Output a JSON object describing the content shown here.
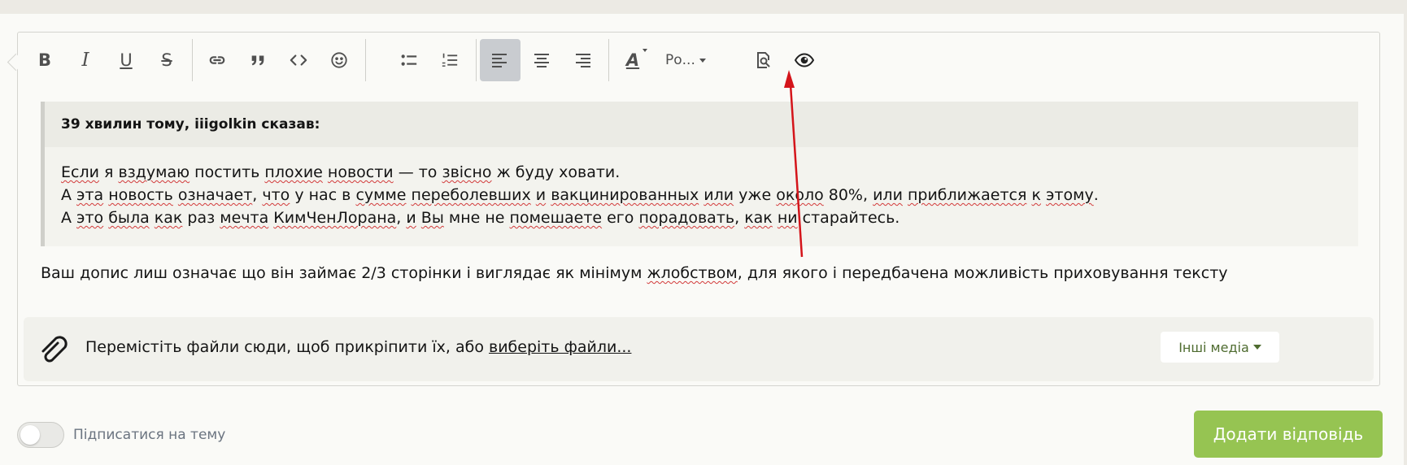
{
  "toolbar": {
    "buttons": [
      {
        "icon": "bold-icon",
        "glyph": "B"
      },
      {
        "icon": "italic-icon",
        "glyph": "I"
      },
      {
        "icon": "underline-icon",
        "glyph": "U"
      },
      {
        "icon": "strikethrough-icon",
        "glyph": "S"
      },
      {
        "icon": "link-icon"
      },
      {
        "icon": "quote-icon"
      },
      {
        "icon": "code-icon"
      },
      {
        "icon": "emoji-icon"
      },
      {
        "icon": "bullet-list-icon"
      },
      {
        "icon": "numbered-list-icon"
      },
      {
        "icon": "align-left-icon",
        "active": true
      },
      {
        "icon": "align-center-icon"
      },
      {
        "icon": "align-right-icon"
      },
      {
        "icon": "text-color-icon",
        "glyph": "A"
      },
      {
        "icon": "preview-icon"
      },
      {
        "icon": "eye-icon"
      }
    ],
    "font_select_label": "Ро..."
  },
  "quote": {
    "header": "39 хвилин тому, iiigolkin сказав:",
    "lines": [
      "Если я вздумаю постить плохие новости — то звісно ж буду ховати.",
      "А эта новость означает, что у нас в сумме переболевших и вакцинированных или уже около 80%, или приближается к этому.",
      "А это была как раз мечта КимЧенЛорана, и Вы мне не помешаете его порадовать, как ни старайтесь."
    ]
  },
  "reply": {
    "text": "Ваш допис лиш означає що він займає 2/3 сторінки і виглядає як мінімум жлобством, для якого і передбачена можливість приховування тексту"
  },
  "attachments": {
    "drop_text": "Перемістіть файли сюди, щоб прикріпити їх, або",
    "choose_link": "виберіть файли...",
    "media_button": "Інші медіа"
  },
  "footer": {
    "subscribe_label": "Підписатися на тему",
    "submit_label": "Додати відповідь"
  },
  "colors": {
    "accent_green": "#96c452",
    "media_text": "#4e6b2f",
    "annotation_arrow": "#d4141a"
  }
}
